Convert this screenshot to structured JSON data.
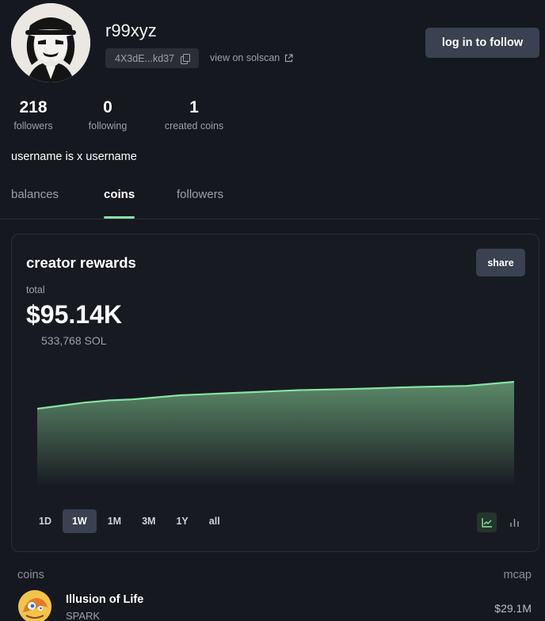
{
  "profile": {
    "username": "r99xyz",
    "address_short": "4X3dE...kd37",
    "solscan_link": "view on solscan",
    "follow_button": "log in to follow",
    "bio": "username is x username"
  },
  "stats": [
    {
      "value": "218",
      "label": "followers"
    },
    {
      "value": "0",
      "label": "following"
    },
    {
      "value": "1",
      "label": "created coins"
    }
  ],
  "tabs": [
    {
      "label": "balances",
      "active": false
    },
    {
      "label": "coins",
      "active": true
    },
    {
      "label": "followers",
      "active": false
    }
  ],
  "rewards": {
    "title": "creator rewards",
    "share_button": "share",
    "total_label": "total",
    "total_usd": "$95.14K",
    "total_sol": "533,768 SOL",
    "ranges": [
      "1D",
      "1W",
      "1M",
      "3M",
      "1Y",
      "all"
    ],
    "active_range": "1W",
    "modes": [
      "line-chart-icon",
      "bar-chart-icon"
    ],
    "active_mode": "line-chart-icon"
  },
  "chart_data": {
    "type": "area",
    "x": [
      0,
      1,
      2,
      3,
      4,
      5,
      6,
      7,
      8,
      9,
      10,
      11,
      12,
      13,
      14,
      15,
      16,
      17,
      18,
      19,
      20
    ],
    "values": [
      0.87,
      0.885,
      0.9,
      0.91,
      0.915,
      0.925,
      0.935,
      0.94,
      0.945,
      0.95,
      0.955,
      0.96,
      0.962,
      0.965,
      0.968,
      0.972,
      0.975,
      0.978,
      0.98,
      0.99,
      1.0
    ],
    "ylim": [
      0,
      1
    ],
    "color": "#86e3a4",
    "grid": false
  },
  "coins_list": {
    "header_left": "coins",
    "header_right": "mcap",
    "items": [
      {
        "name": "Illusion of Life",
        "ticker": "SPARK",
        "mcap": "$29.1M"
      }
    ]
  },
  "colors": {
    "accent": "#86e3a4",
    "background": "#16181f",
    "button": "#3a4150"
  }
}
